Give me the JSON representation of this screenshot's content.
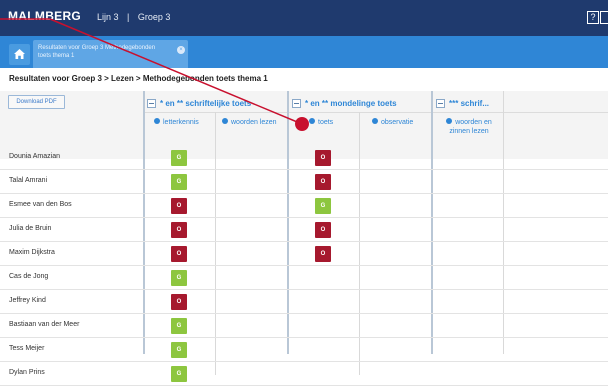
{
  "app": {
    "logo": "MALMBERG",
    "nav": [
      "Lijn 3",
      "Groep 3"
    ],
    "help_label": "?"
  },
  "tabs": {
    "active_tab_label": "Resultaten voor Groep 3 Methodegebonden toets thema 1",
    "close_symbol": "×"
  },
  "page": {
    "breadcrumb": "Resultaten voor Groep 3 > Lezen > Methodegebonden toets thema 1",
    "download_label": "Download PDF"
  },
  "columns": {
    "groups": [
      {
        "label": "* en ** schriftelijke toets"
      },
      {
        "label": "* en ** mondelinge toets"
      },
      {
        "label": "*** schrif..."
      }
    ],
    "subcolumns": [
      "letterkennis",
      "woorden lezen",
      "toets",
      "observatie",
      "woorden en zinnen lezen"
    ]
  },
  "students": [
    {
      "name": "Dounia Amazian",
      "letterkennis": "G",
      "toets": "O"
    },
    {
      "name": "Talal Amrani",
      "letterkennis": "G",
      "toets": "O"
    },
    {
      "name": "Esmee van den Bos",
      "letterkennis": "O",
      "toets": "G"
    },
    {
      "name": "Julia de Bruin",
      "letterkennis": "O",
      "toets": "O"
    },
    {
      "name": "Maxim Dijkstra",
      "letterkennis": "O",
      "toets": "O"
    },
    {
      "name": "Cas de Jong",
      "letterkennis": "G",
      "toets": ""
    },
    {
      "name": "Jeffrey Kind",
      "letterkennis": "O",
      "toets": ""
    },
    {
      "name": "Bastiaan van der Meer",
      "letterkennis": "G",
      "toets": ""
    },
    {
      "name": "Tess Meijer",
      "letterkennis": "G",
      "toets": ""
    },
    {
      "name": "Dylan Prins",
      "letterkennis": "G",
      "toets": ""
    }
  ],
  "colors": {
    "topbar": "#1f3a6e",
    "tabbar": "#2f86d6",
    "good": "#8dc63f",
    "insufficient": "#a6192e",
    "annotation": "#c8102e"
  }
}
